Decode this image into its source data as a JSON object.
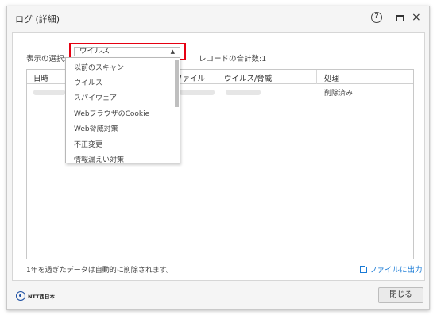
{
  "window": {
    "title": "ログ (詳細)",
    "help_label": "?",
    "close_label": "×"
  },
  "filter": {
    "label": "表示の選択:",
    "selected": "ウイルス",
    "record_count": "レコードの合計数:1"
  },
  "table": {
    "headers": [
      "日時",
      "ファイル",
      "ウイルス/脅威",
      "処理"
    ],
    "rows": [
      {
        "status": "削除済み"
      }
    ]
  },
  "dropdown": {
    "options": [
      "以前のスキャン",
      "ウイルス",
      "スパイウェア",
      "WebブラウザのCookie",
      "Web脅威対策",
      "不正変更",
      "情報漏えい対策"
    ]
  },
  "footer": {
    "retention_note": "1年を過ぎたデータは自動的に削除されます。",
    "export_label": "ファイルに出力",
    "logo_text": "NTT西日本",
    "close_label": "閉じる"
  }
}
